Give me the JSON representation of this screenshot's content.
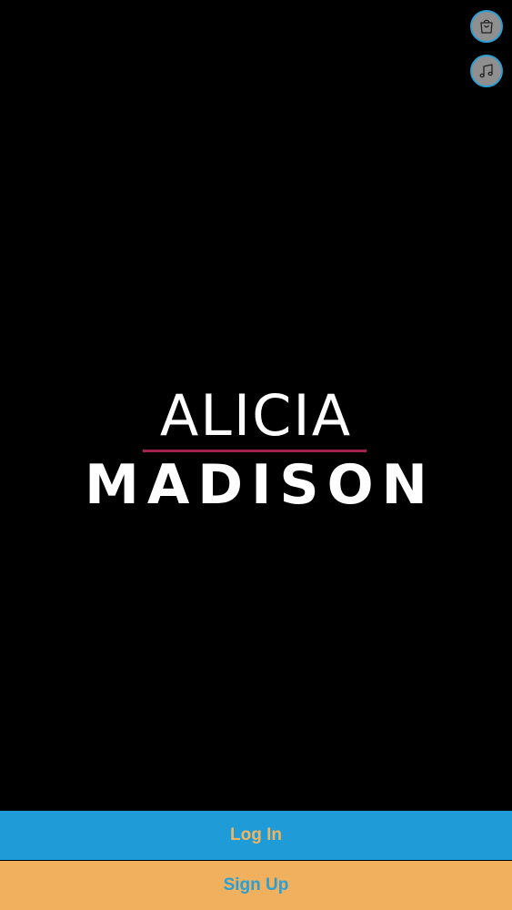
{
  "header": {
    "cart_icon": "shopping-bag-icon",
    "music_icon": "music-note-icon"
  },
  "logo": {
    "line1": "ALICIA",
    "line2": "MADISON"
  },
  "actions": {
    "login_label": "Log In",
    "signup_label": "Sign Up"
  },
  "colors": {
    "background": "#000000",
    "accent_blue": "#1f9bd7",
    "accent_orange": "#f0b05e",
    "logo_rule": "#a3204f",
    "fab_gray": "#8f8f8f"
  }
}
